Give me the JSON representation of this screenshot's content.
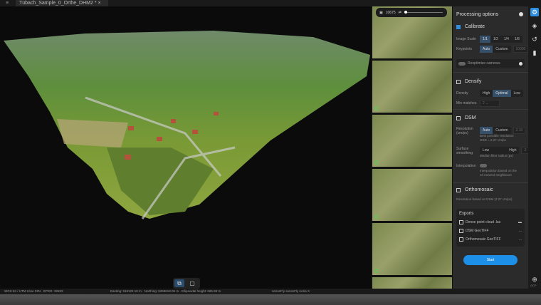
{
  "window": {
    "tab_title": "Tübach_Sample_0_Orthe_DHM2 *",
    "close": "×",
    "menu_icon": "≡"
  },
  "viewport": {
    "tools": [
      "point-cloud-view",
      "plane-view"
    ]
  },
  "strip": {
    "image_count_label": "10675",
    "photo_count": 6
  },
  "panel": {
    "title": "Processing options",
    "calibrate": {
      "label": "Calibrate",
      "checked": true,
      "image_scale_label": "Image Scale",
      "image_scale_options": [
        "1/1",
        "1/2",
        "1/4",
        "1/8"
      ],
      "image_scale_selected": "1/1",
      "keypoints_label": "Keypoints",
      "keypoints_options": [
        "Auto",
        "Custom"
      ],
      "keypoints_selected": "Auto",
      "keypoints_value": "10000",
      "reoptimize_label": "Reoptimize cameras"
    },
    "densify": {
      "label": "Densify",
      "checked": false,
      "density_label": "Density",
      "density_options": [
        "High",
        "Optimal",
        "Low"
      ],
      "density_selected": "Optimal",
      "min_matches_label": "Min matches",
      "min_matches_value": "2"
    },
    "dsm": {
      "label": "DSM",
      "checked": false,
      "resolution_label": "Resolution (cm/px)",
      "resolution_options": [
        "Auto",
        "Custom"
      ],
      "resolution_selected": "Auto",
      "resolution_value": "2.10",
      "resolution_hint": "Best possible resolution GSD = 2.27 cm/px",
      "smoothing_label": "Surface smoothing",
      "smoothing_options": [
        "Low",
        "High"
      ],
      "smoothing_value": "2",
      "smoothing_hint": "Median filter radius (px)",
      "interpolation_label": "Interpolation",
      "interpolation_hint": "Interpolation based on the 10 nearest neighbours"
    },
    "orthomosaic": {
      "label": "Orthomosaic",
      "checked": false,
      "hint": "Resolution based on DSM (2.27 cm/px)"
    },
    "exports": {
      "title": "Exports",
      "items": [
        {
          "label": "Dense point cloud .las",
          "action": "folder"
        },
        {
          "label": "DSM GeoTIFF",
          "action": "..."
        },
        {
          "label": "Orthomosaic GeoTIFF",
          "action": "..."
        }
      ]
    },
    "start_label": "Start"
  },
  "iconbar": {
    "gcp_label": "GCP"
  },
  "status": {
    "crs": "WGS 84 / UTM zone 32N · EPSG: 32632",
    "coords": "Easting: 518122.10 m · Northing: 5269618.05 m · Ellipsoidal height: 665.89 m",
    "camera": "senseFly senseFly Aeria X"
  }
}
